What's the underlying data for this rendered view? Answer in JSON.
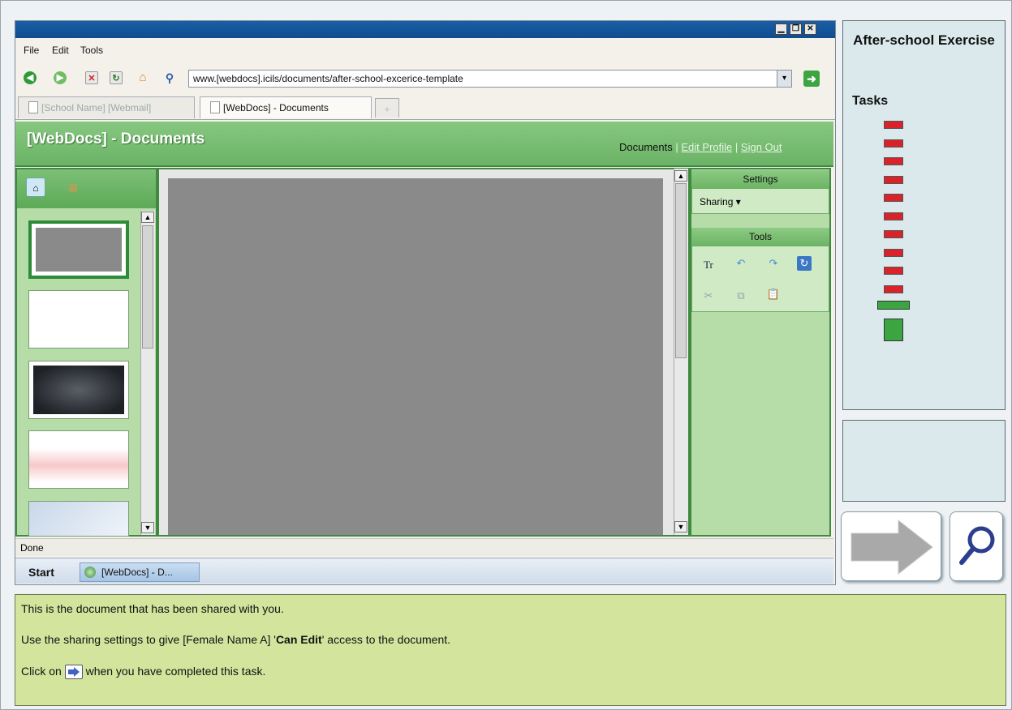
{
  "browser": {
    "menu": [
      "File",
      "Edit",
      "Tools"
    ],
    "window_controls": [
      "minimize",
      "restore",
      "close"
    ],
    "url": "www.[webdocs].icils/documents/after-school-excerice-template",
    "tabs": [
      {
        "label": "[School Name] [Webmail]",
        "active": false
      },
      {
        "label": "[WebDocs] - Documents",
        "active": true
      }
    ],
    "status": "Done"
  },
  "app": {
    "title": "[WebDocs] - Documents",
    "links": {
      "documents": "Documents",
      "edit_profile": "Edit Profile",
      "sign_out": "Sign Out",
      "separator": "|"
    },
    "settings": {
      "header": "Settings",
      "sharing_label": "Sharing ▾"
    },
    "tools": {
      "header": "Tools",
      "items": [
        "text-format-icon",
        "undo-icon",
        "redo-icon",
        "refresh-icon",
        "cut-icon",
        "copy-icon",
        "paste-icon"
      ]
    }
  },
  "taskbar": {
    "start": "Start",
    "item": "[WebDocs] - D..."
  },
  "sidebar": {
    "title": "After-school Exercise",
    "tasks_label": "Tasks",
    "tasks": {
      "total": 12,
      "incomplete": 10,
      "current_index": 11,
      "completed_marker_index": 12
    }
  },
  "instructions": {
    "line1": "This is the document that has been shared with you.",
    "line2_pre": "Use the sharing settings to give [Female Name A] '",
    "line2_bold": "Can Edit",
    "line2_post": "' access to the document.",
    "line3_pre": "Click on",
    "line3_post": "when you have completed this task."
  },
  "colors": {
    "header_green": "#6bb366",
    "panel_green": "#b6dda7",
    "task_red": "#d9232a",
    "task_green": "#3da442",
    "instr_bg": "#d3e49d"
  }
}
